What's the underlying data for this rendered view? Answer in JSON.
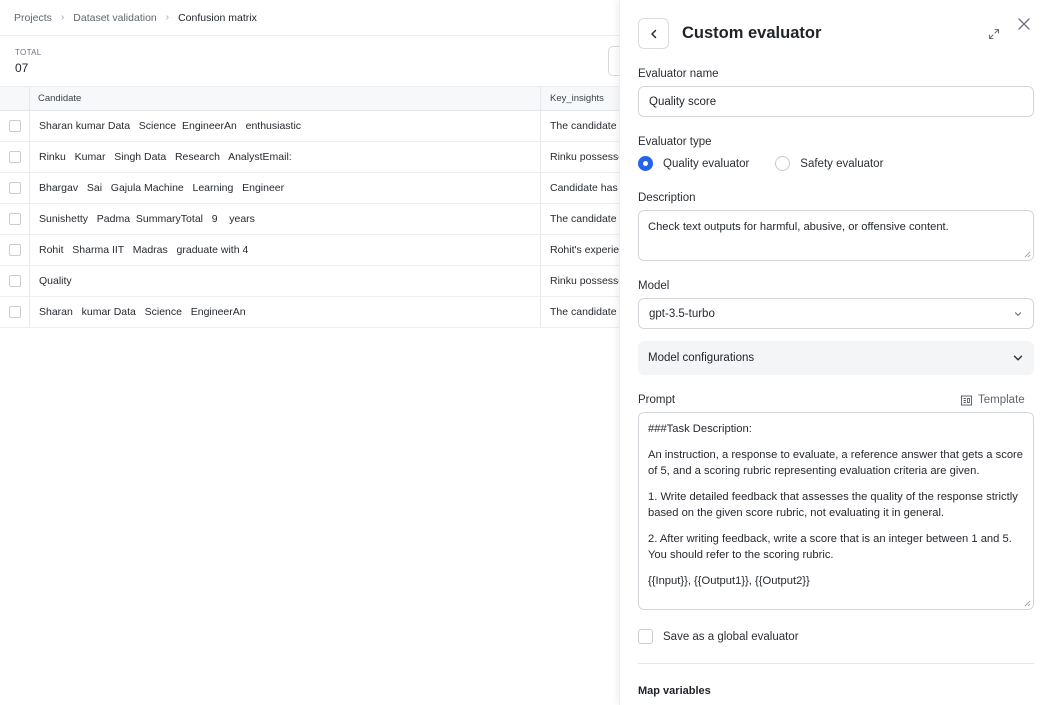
{
  "breadcrumb": [
    "Projects",
    "Dataset validation",
    "Confusion matrix"
  ],
  "summary": {
    "total_label": "TOTAL",
    "total_value": "07"
  },
  "table": {
    "headers": {
      "candidate": "Candidate",
      "key_insights": "Key_insights"
    },
    "rows": [
      {
        "candidate": "Sharan kumar Data   Science  EngineerAn   enthusiastic",
        "key_insights": "The candidate"
      },
      {
        "candidate": "Rinku   Kumar   Singh Data   Research   AnalystEmail:",
        "key_insights": "Rinku possesses"
      },
      {
        "candidate": "Bhargav   Sai   Gajula Machine   Learning   Engineer",
        "key_insights": "Candidate has"
      },
      {
        "candidate": "Sunishetty   Padma  SummaryTotal   9    years",
        "key_insights": "The candidate"
      },
      {
        "candidate": "Rohit   Sharma IIT   Madras   graduate with 4",
        "key_insights": "Rohit's experience"
      },
      {
        "candidate": "Quality",
        "key_insights": "Rinku possesses"
      },
      {
        "candidate": "Sharan   kumar Data   Science   EngineerAn",
        "key_insights": "The candidate"
      }
    ]
  },
  "drawer": {
    "title": "Custom evaluator",
    "evaluator_name_label": "Evaluator name",
    "evaluator_name_value": "Quality score",
    "evaluator_type_label": "Evaluator type",
    "type_options": [
      {
        "label": "Quality evaluator",
        "selected": true
      },
      {
        "label": "Safety evaluator",
        "selected": false
      }
    ],
    "description_label": "Description",
    "description_value": "Check text outputs for harmful, abusive, or offensive content.",
    "model_label": "Model",
    "model_value": "gpt-3.5-turbo",
    "model_config_label": "Model configurations",
    "prompt_label": "Prompt",
    "template_label": "Template",
    "prompt_paragraphs": [
      "###Task Description:",
      "An instruction, a response to evaluate, a reference answer that gets a score of 5, and a scoring rubric representing evaluation criteria are given.",
      "1. Write detailed feedback that assesses the quality of the response strictly based on the given score rubric, not evaluating it in general.",
      "2. After writing feedback, write a score that is an integer between 1 and 5. You should refer to the scoring rubric.",
      "{{Input}}, {{Output1}}, {{Output2}}"
    ],
    "global_label": "Save as a global evaluator",
    "map_variables_label": "Map variables"
  },
  "colors": {
    "accent": "#2563eb",
    "border": "#d3d7dc",
    "muted_bg": "#f4f5f7"
  }
}
